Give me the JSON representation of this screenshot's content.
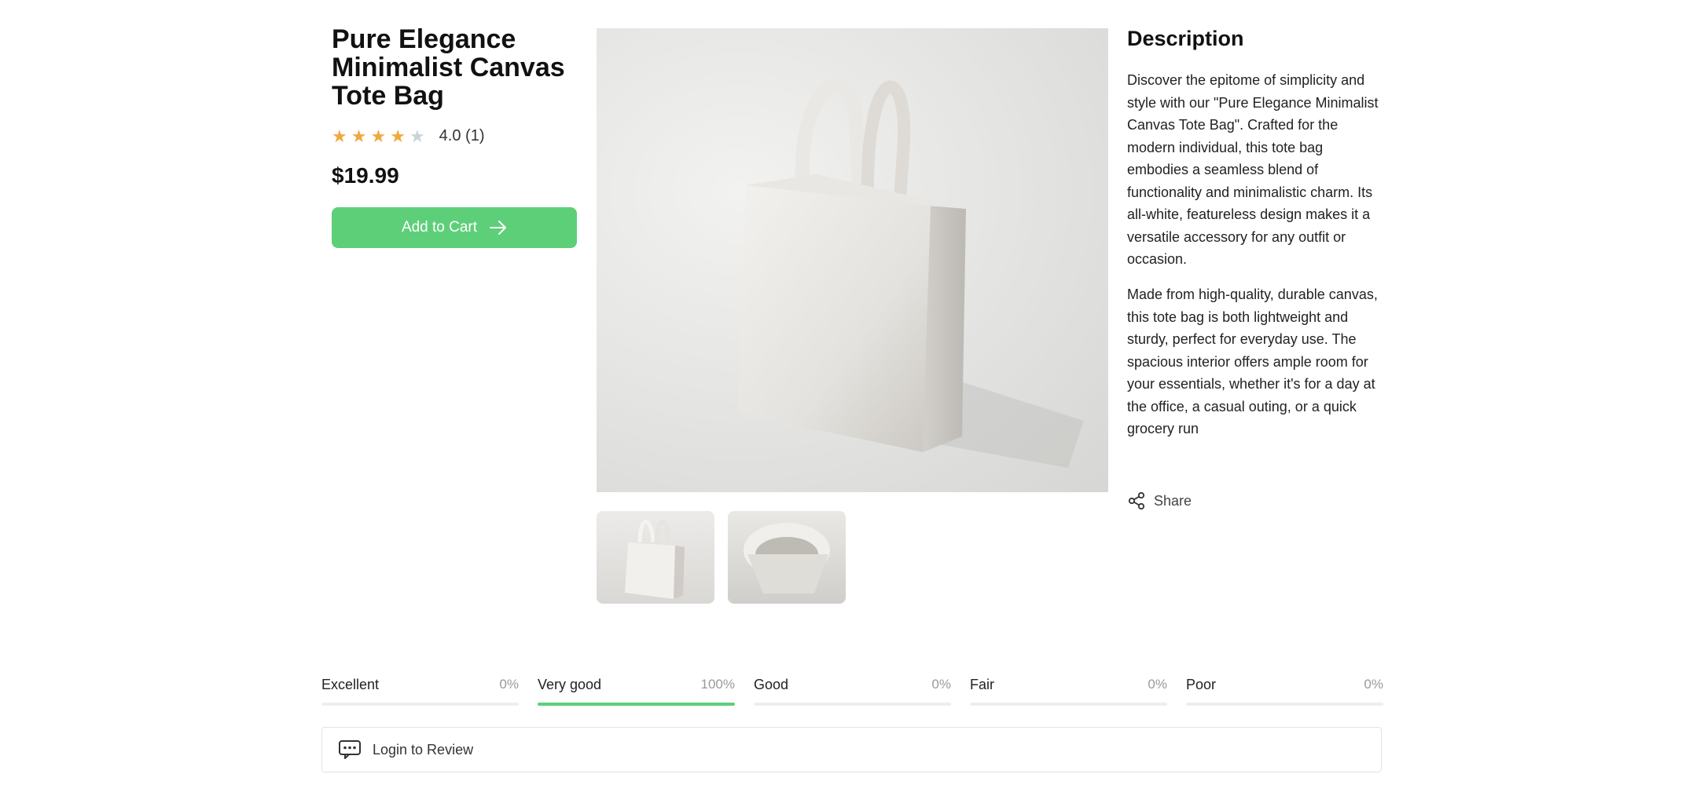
{
  "product": {
    "title": "Pure Elegance Minimalist Canvas Tote Bag",
    "rating_value": 4,
    "rating_max": 5,
    "rating_text": "4.0 (1)",
    "price": "$19.99",
    "add_to_cart_label": "Add to Cart",
    "star_color": "#f0a83c",
    "star_empty_color": "#c9d3d8",
    "accent_color": "#5ecf79"
  },
  "description": {
    "title": "Description",
    "paragraph1": "Discover the epitome of simplicity and style with our \"Pure Elegance Minimalist Canvas Tote Bag\". Crafted for the modern individual, this tote bag embodies a seamless blend of functionality and minimalistic charm. Its all-white, featureless design makes it a versatile accessory for any outfit or occasion.",
    "paragraph2": "Made from high-quality, durable canvas, this tote bag is both lightweight and sturdy, perfect for everyday use. The spacious interior offers ample room for your essentials, whether it's for a day at the office, a casual outing, or a quick grocery run",
    "share_label": "Share"
  },
  "reviews": {
    "breakdown": [
      {
        "label": "Excellent",
        "percent_text": "0%",
        "percent": 0
      },
      {
        "label": "Very good",
        "percent_text": "100%",
        "percent": 100
      },
      {
        "label": "Good",
        "percent_text": "0%",
        "percent": 0
      },
      {
        "label": "Fair",
        "percent_text": "0%",
        "percent": 0
      },
      {
        "label": "Poor",
        "percent_text": "0%",
        "percent": 0
      }
    ],
    "login_label": "Login to Review"
  }
}
